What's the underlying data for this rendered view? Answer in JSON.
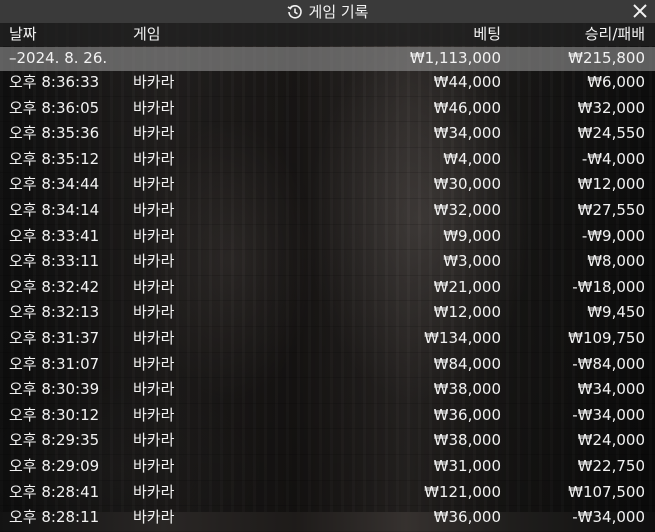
{
  "title": "게임 기록",
  "icons": {
    "title": "history-icon",
    "close": "close-icon"
  },
  "columns": {
    "date": "날짜",
    "game": "게임",
    "bet": "베팅",
    "winloss": "승리/패배"
  },
  "summary": {
    "date": "–2024. 8. 26.",
    "bet": "₩1,113,000",
    "winloss": "₩215,800"
  },
  "rows": [
    {
      "time": "오후 8:36:33",
      "game": "바카라",
      "bet": "₩44,000",
      "winloss": "₩6,000"
    },
    {
      "time": "오후 8:36:05",
      "game": "바카라",
      "bet": "₩46,000",
      "winloss": "₩32,000"
    },
    {
      "time": "오후 8:35:36",
      "game": "바카라",
      "bet": "₩34,000",
      "winloss": "₩24,550"
    },
    {
      "time": "오후 8:35:12",
      "game": "바카라",
      "bet": "₩4,000",
      "winloss": "-₩4,000"
    },
    {
      "time": "오후 8:34:44",
      "game": "바카라",
      "bet": "₩30,000",
      "winloss": "₩12,000"
    },
    {
      "time": "오후 8:34:14",
      "game": "바카라",
      "bet": "₩32,000",
      "winloss": "₩27,550"
    },
    {
      "time": "오후 8:33:41",
      "game": "바카라",
      "bet": "₩9,000",
      "winloss": "-₩9,000"
    },
    {
      "time": "오후 8:33:11",
      "game": "바카라",
      "bet": "₩3,000",
      "winloss": "₩8,000"
    },
    {
      "time": "오후 8:32:42",
      "game": "바카라",
      "bet": "₩21,000",
      "winloss": "-₩18,000"
    },
    {
      "time": "오후 8:32:13",
      "game": "바카라",
      "bet": "₩12,000",
      "winloss": "₩9,450"
    },
    {
      "time": "오후 8:31:37",
      "game": "바카라",
      "bet": "₩134,000",
      "winloss": "₩109,750"
    },
    {
      "time": "오후 8:31:07",
      "game": "바카라",
      "bet": "₩84,000",
      "winloss": "-₩84,000"
    },
    {
      "time": "오후 8:30:39",
      "game": "바카라",
      "bet": "₩38,000",
      "winloss": "₩34,000"
    },
    {
      "time": "오후 8:30:12",
      "game": "바카라",
      "bet": "₩36,000",
      "winloss": "-₩34,000"
    },
    {
      "time": "오후 8:29:35",
      "game": "바카라",
      "bet": "₩38,000",
      "winloss": "₩24,000"
    },
    {
      "time": "오후 8:29:09",
      "game": "바카라",
      "bet": "₩31,000",
      "winloss": "₩22,750"
    },
    {
      "time": "오후 8:28:41",
      "game": "바카라",
      "bet": "₩121,000",
      "winloss": "₩107,500"
    },
    {
      "time": "오후 8:28:11",
      "game": "바카라",
      "bet": "₩36,000",
      "winloss": "-₩34,000"
    }
  ]
}
